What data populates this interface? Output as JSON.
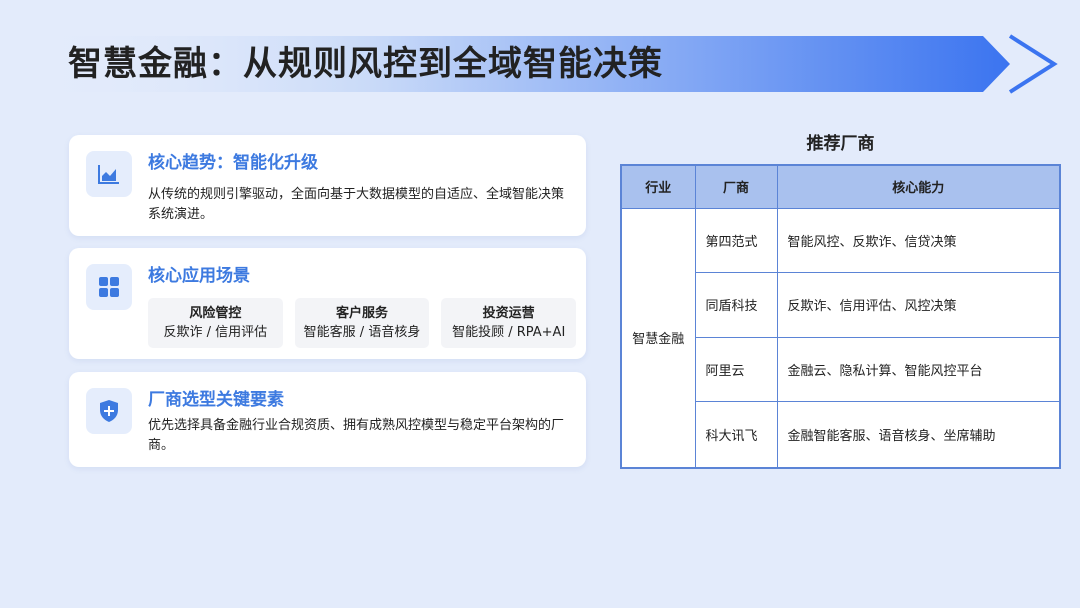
{
  "title": "智慧金融：从规则风控到全域智能决策",
  "cards": {
    "trend": {
      "title": "核心趋势：智能化升级",
      "body": "从传统的规则引擎驱动，全面向基于大数据模型的自适应、全域智能决策系统演进。",
      "icon": "chart-icon"
    },
    "scenes": {
      "title": "核心应用场景",
      "icon": "grid-icon",
      "items": [
        {
          "name": "风险管控",
          "desc": "反欺诈 / 信用评估"
        },
        {
          "name": "客户服务",
          "desc": "智能客服 / 语音核身"
        },
        {
          "name": "投资运营",
          "desc": "智能投顾 / RPA+AI"
        }
      ]
    },
    "selection": {
      "title": "厂商选型关键要素",
      "body": "优先选择具备金融行业合规资质、拥有成熟风控模型与稳定平台架构的厂商。",
      "icon": "shield-plus-icon"
    }
  },
  "table": {
    "title": "推荐厂商",
    "headers": [
      "行业",
      "厂商",
      "核心能力"
    ],
    "industry": "智慧金融",
    "rows": [
      {
        "vendor": "第四范式",
        "capability": "智能风控、反欺诈、信贷决策"
      },
      {
        "vendor": "同盾科技",
        "capability": "反欺诈、信用评估、风控决策"
      },
      {
        "vendor": "阿里云",
        "capability": "金融云、隐私计算、智能风控平台"
      },
      {
        "vendor": "科大讯飞",
        "capability": "金融智能客服、语音核身、坐席辅助"
      }
    ]
  },
  "colors": {
    "accent": "#3d7ae0",
    "background": "#e3ebfb",
    "table_header": "#a9c1ee",
    "table_border": "#5b84d6"
  }
}
